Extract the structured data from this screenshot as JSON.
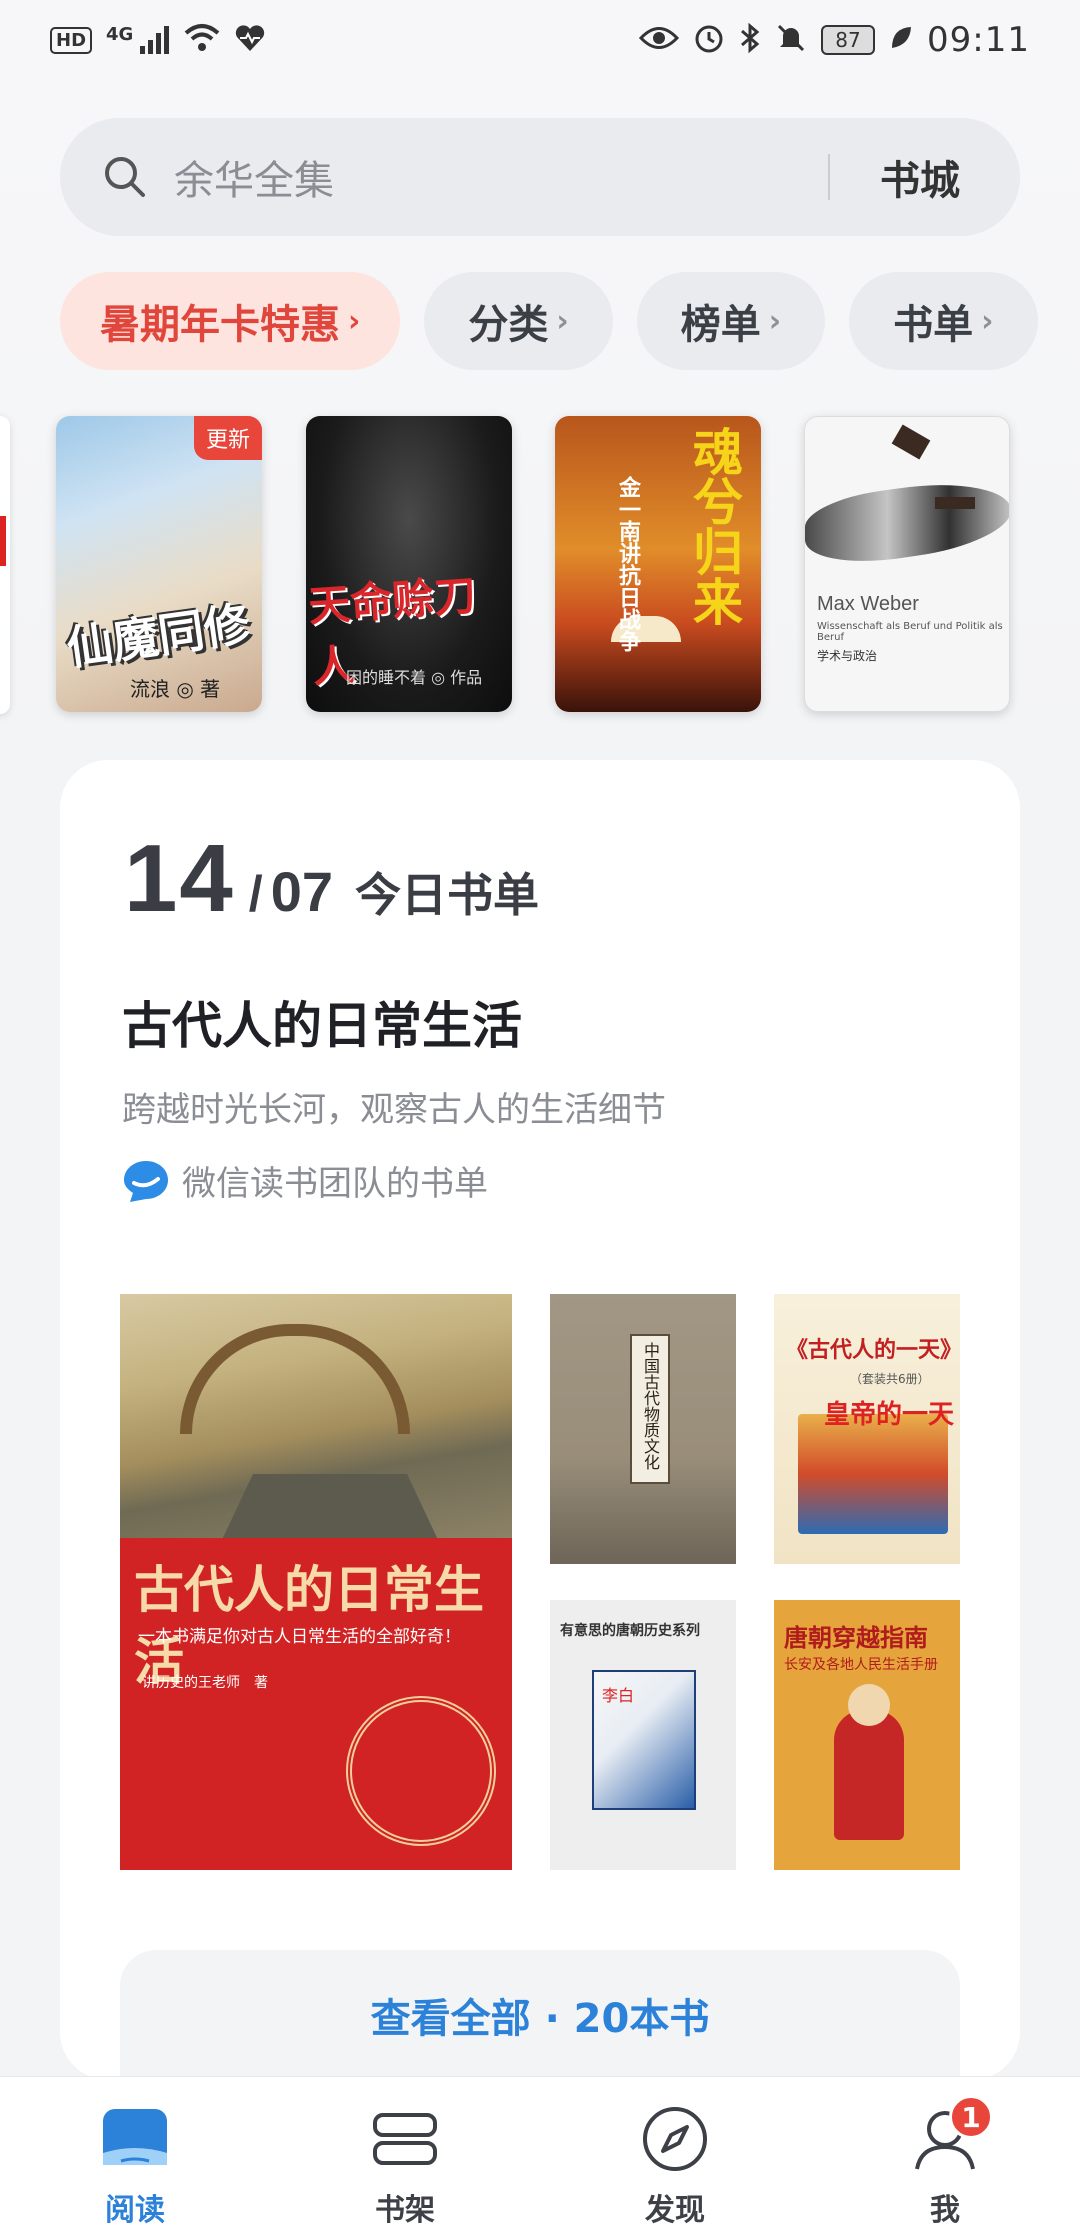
{
  "status_bar": {
    "hd": "HD",
    "network": "4G",
    "battery": "87",
    "time": "09:11",
    "icons": [
      "eye-icon",
      "alarm-icon",
      "bluetooth-icon",
      "mute-icon",
      "leaf-icon"
    ]
  },
  "search": {
    "placeholder": "余华全集",
    "store_label": "书城"
  },
  "chips": [
    {
      "label": "暑期年卡特惠",
      "promo": true
    },
    {
      "label": "分类"
    },
    {
      "label": "榜单"
    },
    {
      "label": "书单"
    }
  ],
  "covers": [
    {
      "title": "仙魔同修",
      "author": "流浪 ◎ 著",
      "badge": "更新"
    },
    {
      "title": "天命赊刀人",
      "author": "困的睡不着 ◎ 作品"
    },
    {
      "title": "魂兮归来",
      "subtitle": "金一南讲抗日战争"
    },
    {
      "title": "Max Weber",
      "subtitle": "Wissenschaft als Beruf und Politik als Beruf",
      "zh": "学术与政治"
    }
  ],
  "booklist": {
    "day": "14",
    "month": "07",
    "date_label": "今日书单",
    "title": "古代人的日常生活",
    "description": "跨越时光长河，观察古人的生活细节",
    "by": "微信读书团队的书单",
    "books": [
      {
        "title": "古代人的日常生活",
        "subtitle": "一本书满足你对古人日常生活的全部好奇！",
        "author": "讲历史的王老师　著"
      },
      {
        "title": "中国古代物质文化"
      },
      {
        "title": "《古代人的一天》",
        "subtitle": "（套装共6册）",
        "cover_text": "皇帝的一天"
      },
      {
        "title": "有意思的唐朝历史系列",
        "cover_text": "李白"
      },
      {
        "title": "唐朝穿越指南",
        "subtitle": "长安及各地人民生活手册"
      }
    ],
    "view_all": "查看全部 · 20本书"
  },
  "nav": {
    "items": [
      {
        "label": "阅读",
        "icon": "book-open-icon",
        "active": true
      },
      {
        "label": "书架",
        "icon": "bookshelf-icon"
      },
      {
        "label": "发现",
        "icon": "compass-icon"
      },
      {
        "label": "我",
        "icon": "user-icon",
        "badge": "1"
      }
    ]
  },
  "colors": {
    "accent": "#2c82d8",
    "promo": "#e0463b",
    "badge": "#e8453b"
  }
}
